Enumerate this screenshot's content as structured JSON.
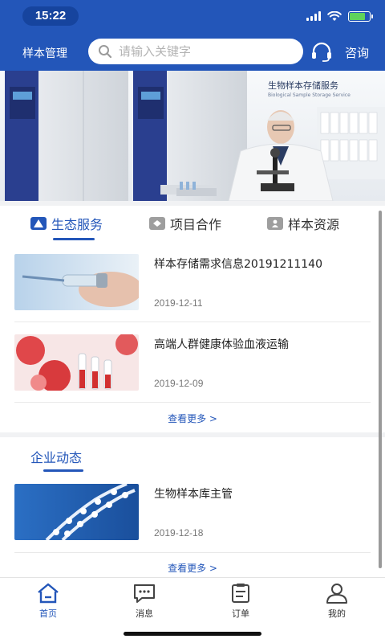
{
  "status": {
    "time": "15:22",
    "battery_level": 0.8,
    "battery_color": "#5fd35b"
  },
  "header": {
    "app_title": "样本管理",
    "search_placeholder": "请输入关键字",
    "consult_label": "咨询",
    "accent": "#2356b9"
  },
  "banner": {
    "caption": "生物样本存储服务",
    "subcaption": "Biological Sample Storage Service"
  },
  "tabs": [
    {
      "label": "生态服务",
      "icon": "service-icon",
      "active": true
    },
    {
      "label": "项目合作",
      "icon": "handshake-icon",
      "active": false
    },
    {
      "label": "样本资源",
      "icon": "person-badge-icon",
      "active": false
    }
  ],
  "services": [
    {
      "title": "样本存储需求信息20191211140",
      "date": "2019-12-11",
      "thumb": "vial-photo"
    },
    {
      "title": "高端人群健康体验血液运输",
      "date": "2019-12-09",
      "thumb": "blood-tubes-photo"
    }
  ],
  "services_more": "查看更多 >",
  "news": {
    "section_title": "企业动态",
    "items": [
      {
        "title": "生物样本库主管",
        "date": "2019-12-18",
        "thumb": "dna-photo"
      }
    ],
    "more": "查看更多 >"
  },
  "tabbar": [
    {
      "label": "首页",
      "icon": "home-icon",
      "active": true
    },
    {
      "label": "消息",
      "icon": "message-icon",
      "active": false
    },
    {
      "label": "订单",
      "icon": "order-icon",
      "active": false
    },
    {
      "label": "我的",
      "icon": "profile-icon",
      "active": false
    }
  ]
}
